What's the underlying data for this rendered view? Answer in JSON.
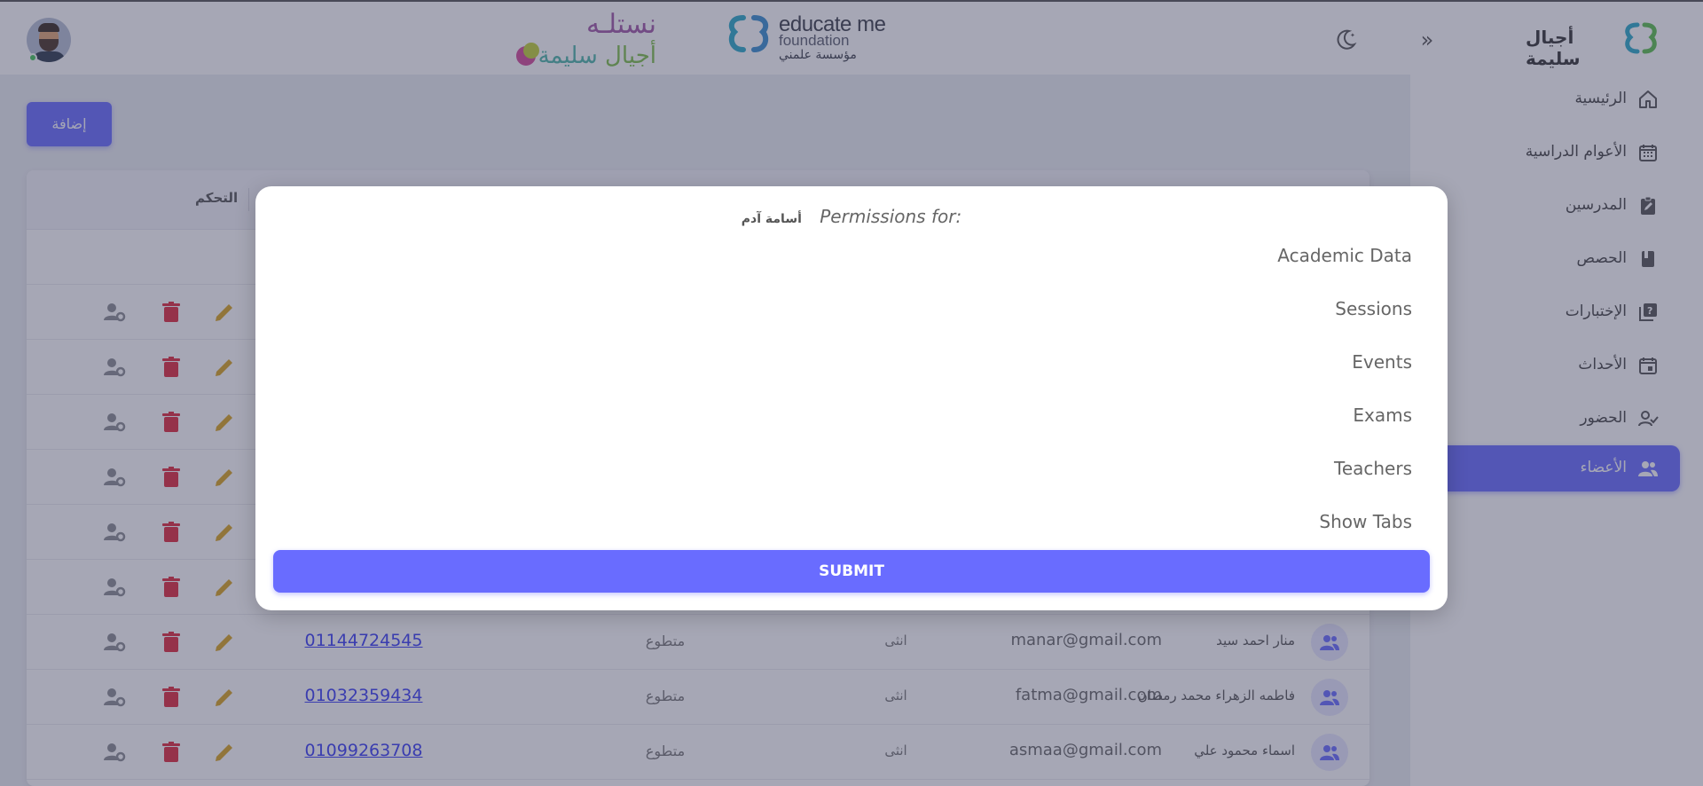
{
  "header": {
    "logo_nastaleh": {
      "title": "نستلـه",
      "sub_a": "أجيال ",
      "sub_b": "سليمة"
    },
    "logo_educate": {
      "line1": "educate me",
      "line2": "foundation",
      "line3": "مؤسسة علمني"
    },
    "brand_name": "أجيال سليمة",
    "collapse_glyph": "»"
  },
  "sidebar": {
    "items": [
      {
        "label": "الرئيسية",
        "icon": "home-icon"
      },
      {
        "label": "الأعوام الدراسية",
        "icon": "calendar-grid-icon"
      },
      {
        "label": "المدرسين",
        "icon": "clipboard-edit-icon"
      },
      {
        "label": "الحصص",
        "icon": "book-icon"
      },
      {
        "label": "الإختبارات",
        "icon": "quiz-icon"
      },
      {
        "label": "الأحداث",
        "icon": "event-icon"
      },
      {
        "label": "الحضور",
        "icon": "user-check-icon"
      },
      {
        "label": "الأعضاء",
        "icon": "users-icon",
        "active": true
      }
    ]
  },
  "main": {
    "add_label": "إضافة",
    "table": {
      "control_header": "التحكم",
      "rows": [
        {
          "phone": "01144724545",
          "role": "متطوع",
          "gender": "انثى",
          "email": "manar@gmail.com",
          "name": "منار احمد سيد"
        },
        {
          "phone": "01032359434",
          "role": "متطوع",
          "gender": "انثى",
          "email": "fatma@gmail.com",
          "name": "فاطمه الزهراء محمد رمضان"
        },
        {
          "phone": "01099263708",
          "role": "متطوع",
          "gender": "انثى",
          "email": "asmaa@gmail.com",
          "name": "اسماء محمود علي"
        }
      ]
    }
  },
  "modal": {
    "title_prefix": "Permissions for:",
    "user_name": "أسامة آدم",
    "permissions": [
      "Academic Data",
      "Sessions",
      "Events",
      "Exams",
      "Teachers",
      "Show Tabs"
    ],
    "submit_label": "SUBMIT"
  },
  "colors": {
    "accent": "#696cff",
    "danger": "#e02a3c",
    "warning": "#d9a520",
    "muted": "#8a8d93"
  }
}
